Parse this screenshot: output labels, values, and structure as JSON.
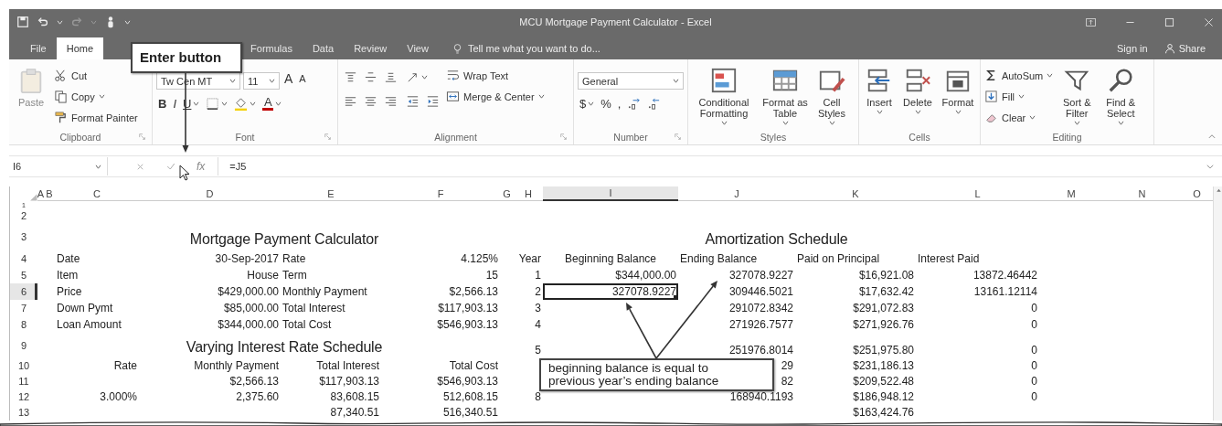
{
  "title_bar": {
    "title": "MCU Mortgage Payment Calculator - Excel"
  },
  "tabs": [
    {
      "label": "File",
      "selected": false
    },
    {
      "label": "Home",
      "selected": true
    },
    {
      "label": "Formulas",
      "selected": false
    },
    {
      "label": "Data",
      "selected": false
    },
    {
      "label": "Review",
      "selected": false
    },
    {
      "label": "View",
      "selected": false
    }
  ],
  "tell_me": {
    "placeholder": "Tell me what you want to do..."
  },
  "account": {
    "sign_in": "Sign in",
    "share": "Share"
  },
  "ribbon": [
    {
      "label": "Clipboard",
      "launcher": true,
      "columns": [
        [
          [
            {
              "kind": "large",
              "label": "Paste",
              "menu": false,
              "disabled": true
            }
          ]
        ],
        [
          [
            {
              "kind": "small",
              "label": "Cut",
              "menu": false,
              "disabled": false
            }
          ],
          [
            {
              "kind": "small",
              "label": "Copy",
              "menu": true,
              "disabled": false
            }
          ],
          [
            {
              "kind": "small",
              "label": "Format Painter",
              "menu": false,
              "disabled": false
            }
          ]
        ]
      ]
    },
    {
      "label": "Font",
      "launcher": true,
      "columns": [
        [
          [
            {
              "kind": "field",
              "value": "Tw Cen MT",
              "menu": true,
              "disabled": false
            },
            {
              "kind": "field",
              "value": "11",
              "menu": true,
              "disabled": false
            },
            {
              "kind": "tool",
              "label": "A",
              "menu": false,
              "disabled": false
            },
            {
              "kind": "tool",
              "label": "A",
              "menu": false,
              "disabled": false
            }
          ],
          [
            {
              "kind": "tool",
              "label": "B",
              "menu": false,
              "disabled": false
            },
            {
              "kind": "tool",
              "label": "I",
              "menu": false,
              "disabled": false
            },
            {
              "kind": "tool",
              "label": "U",
              "menu": true,
              "disabled": false
            },
            {
              "kind": "tool",
              "menu": true,
              "disabled": false
            },
            {
              "kind": "tool",
              "menu": true,
              "disabled": false
            },
            {
              "kind": "tool",
              "label": "A",
              "menu": true,
              "disabled": false
            }
          ]
        ]
      ]
    },
    {
      "label": "Alignment",
      "launcher": true,
      "columns": [
        [
          [
            {
              "kind": "tool",
              "menu": false,
              "disabled": false
            },
            {
              "kind": "tool",
              "menu": false,
              "disabled": false
            },
            {
              "kind": "tool",
              "menu": false,
              "disabled": false
            }
          ],
          [
            {
              "kind": "tool",
              "menu": false,
              "disabled": false
            },
            {
              "kind": "tool",
              "menu": false,
              "disabled": false
            },
            {
              "kind": "tool",
              "menu": false,
              "disabled": false
            }
          ]
        ],
        [
          [
            {
              "kind": "tool",
              "menu": true,
              "disabled": false
            }
          ],
          [
            {
              "kind": "tool",
              "menu": false,
              "disabled": false
            },
            {
              "kind": "tool",
              "menu": false,
              "disabled": false
            }
          ]
        ],
        [
          [
            {
              "kind": "small",
              "label": "Wrap Text",
              "menu": false,
              "disabled": false
            }
          ],
          [
            {
              "kind": "small",
              "label": "Merge & Center",
              "menu": true,
              "disabled": false
            }
          ]
        ]
      ]
    },
    {
      "label": "Number",
      "launcher": true,
      "columns": [
        [
          [
            {
              "kind": "field",
              "value": "General",
              "menu": true,
              "disabled": false
            }
          ],
          [
            {
              "kind": "tool",
              "label": "$",
              "menu": true,
              "disabled": false
            },
            {
              "kind": "tool",
              "label": "%",
              "menu": false,
              "disabled": false
            },
            {
              "kind": "tool",
              "label": ",",
              "menu": false,
              "disabled": false
            },
            {
              "kind": "tool",
              "menu": false,
              "disabled": false
            },
            {
              "kind": "tool",
              "menu": false,
              "disabled": false
            }
          ]
        ]
      ]
    },
    {
      "label": "Styles",
      "launcher": false,
      "columns": [
        [
          [
            {
              "kind": "large",
              "label": "Conditional Formatting",
              "menu": true,
              "disabled": false
            }
          ]
        ],
        [
          [
            {
              "kind": "large",
              "label": "Format as Table",
              "menu": true,
              "disabled": false
            }
          ]
        ],
        [
          [
            {
              "kind": "large",
              "label": "Cell Styles",
              "menu": true,
              "disabled": false
            }
          ]
        ]
      ]
    },
    {
      "label": "Cells",
      "launcher": false,
      "columns": [
        [
          [
            {
              "kind": "large",
              "label": "Insert",
              "menu": true,
              "disabled": false
            }
          ]
        ],
        [
          [
            {
              "kind": "large",
              "label": "Delete",
              "menu": true,
              "disabled": false
            }
          ]
        ],
        [
          [
            {
              "kind": "large",
              "label": "Format",
              "menu": true,
              "disabled": false
            }
          ]
        ]
      ]
    },
    {
      "label": "Editing",
      "launcher": false,
      "columns": [
        [
          [
            {
              "kind": "small",
              "label": "AutoSum",
              "menu": true,
              "disabled": false
            }
          ],
          [
            {
              "kind": "small",
              "label": "Fill",
              "menu": true,
              "disabled": false
            }
          ],
          [
            {
              "kind": "small",
              "label": "Clear",
              "menu": true,
              "disabled": false
            }
          ]
        ],
        [
          [
            {
              "kind": "large",
              "label": "Sort & Filter",
              "menu": true,
              "disabled": false
            }
          ]
        ],
        [
          [
            {
              "kind": "large",
              "label": "Find & Select",
              "menu": true,
              "disabled": false
            }
          ]
        ]
      ]
    }
  ],
  "formula_bar": {
    "name_box": "I6",
    "function_label": "fx",
    "value": "=J5"
  },
  "sheet": {
    "columns": [
      {
        "label": "A",
        "selected": false
      },
      {
        "label": "B",
        "selected": false
      },
      {
        "label": "C",
        "selected": false
      },
      {
        "label": "D",
        "selected": false
      },
      {
        "label": "E",
        "selected": false
      },
      {
        "label": "F",
        "selected": false
      },
      {
        "label": "G",
        "selected": false
      },
      {
        "label": "H",
        "selected": false
      },
      {
        "label": "I",
        "selected": true
      },
      {
        "label": "J",
        "selected": false
      },
      {
        "label": "K",
        "selected": false
      },
      {
        "label": "L",
        "selected": false
      },
      {
        "label": "M",
        "selected": false
      },
      {
        "label": "N",
        "selected": false
      },
      {
        "label": "O",
        "selected": false
      }
    ],
    "rows": [
      {
        "label": "1",
        "selected": false
      },
      {
        "label": "2",
        "selected": false
      },
      {
        "label": "3",
        "selected": false,
        "cells": [
          {
            "kind": "blank"
          },
          {
            "kind": "blank"
          },
          {
            "kind": "title",
            "text": "Mortgage Payment Calculator"
          },
          {
            "kind": "blank"
          },
          {
            "kind": "blank"
          },
          {
            "kind": "blank"
          },
          {
            "kind": "blank"
          },
          {
            "kind": "title",
            "text": "Amortization Schedule"
          },
          {
            "kind": "blank"
          },
          {
            "kind": "blank"
          },
          {
            "kind": "blank"
          },
          {
            "kind": "blank"
          }
        ]
      },
      {
        "label": "4",
        "selected": false,
        "cells": [
          {
            "kind": "blank"
          },
          {
            "kind": "blank"
          },
          {
            "kind": "left",
            "text": "Date"
          },
          {
            "kind": "right",
            "text": "30-Sep-2017"
          },
          {
            "kind": "left",
            "text": "Rate"
          },
          {
            "kind": "right",
            "text": "4.125%"
          },
          {
            "kind": "blank"
          },
          {
            "kind": "right",
            "text": "Year"
          },
          {
            "kind": "center",
            "text": "Beginning Balance"
          },
          {
            "kind": "left",
            "text": "Ending Balance"
          },
          {
            "kind": "left",
            "text": "Paid on Principal"
          },
          {
            "kind": "left",
            "text": "Interest Paid"
          }
        ]
      },
      {
        "label": "5",
        "selected": false,
        "cells": [
          {
            "kind": "blank"
          },
          {
            "kind": "blank"
          },
          {
            "kind": "left",
            "text": "Item"
          },
          {
            "kind": "right",
            "text": "House"
          },
          {
            "kind": "left",
            "text": "Term"
          },
          {
            "kind": "right",
            "text": "15"
          },
          {
            "kind": "blank"
          },
          {
            "kind": "right",
            "text": "1"
          },
          {
            "kind": "right",
            "text": "$344,000.00"
          },
          {
            "kind": "right",
            "text": "327078.9227"
          },
          {
            "kind": "right",
            "text": "$16,921.08"
          },
          {
            "kind": "right",
            "text": "13872.46442"
          }
        ]
      },
      {
        "label": "6",
        "selected": true,
        "cells": [
          {
            "kind": "blank"
          },
          {
            "kind": "blank"
          },
          {
            "kind": "left",
            "text": "Price"
          },
          {
            "kind": "right",
            "text": "$429,000.00"
          },
          {
            "kind": "left",
            "text": "Monthly Payment"
          },
          {
            "kind": "right",
            "text": "$2,566.13"
          },
          {
            "kind": "blank"
          },
          {
            "kind": "right",
            "text": "2"
          },
          {
            "kind": "right",
            "text": "327078.9227"
          },
          {
            "kind": "right",
            "text": "309446.5021"
          },
          {
            "kind": "right",
            "text": "$17,632.42"
          },
          {
            "kind": "right",
            "text": "13161.12114"
          }
        ]
      },
      {
        "label": "7",
        "selected": false,
        "cells": [
          {
            "kind": "blank"
          },
          {
            "kind": "blank"
          },
          {
            "kind": "left",
            "text": "Down Pymt"
          },
          {
            "kind": "right",
            "text": "$85,000.00"
          },
          {
            "kind": "left",
            "text": "Total Interest"
          },
          {
            "kind": "right",
            "text": "$117,903.13"
          },
          {
            "kind": "blank"
          },
          {
            "kind": "right",
            "text": "3"
          },
          {
            "kind": "blank"
          },
          {
            "kind": "right",
            "text": "291072.8342"
          },
          {
            "kind": "right",
            "text": "$291,072.83"
          },
          {
            "kind": "right",
            "text": "0"
          }
        ]
      },
      {
        "label": "8",
        "selected": false,
        "cells": [
          {
            "kind": "blank"
          },
          {
            "kind": "blank"
          },
          {
            "kind": "left",
            "text": "Loan Amount"
          },
          {
            "kind": "right",
            "text": "$344,000.00"
          },
          {
            "kind": "left",
            "text": "Total Cost"
          },
          {
            "kind": "right",
            "text": "$546,903.13"
          },
          {
            "kind": "blank"
          },
          {
            "kind": "right",
            "text": "4"
          },
          {
            "kind": "blank"
          },
          {
            "kind": "right",
            "text": "271926.7577"
          },
          {
            "kind": "right",
            "text": "$271,926.76"
          },
          {
            "kind": "right",
            "text": "0"
          }
        ]
      },
      {
        "label": "9",
        "selected": false,
        "cells": [
          {
            "kind": "blank"
          },
          {
            "kind": "blank"
          },
          {
            "kind": "title",
            "text": "Varying Interest Rate Schedule"
          },
          {
            "kind": "blank"
          },
          {
            "kind": "blank"
          },
          {
            "kind": "blank"
          },
          {
            "kind": "blank"
          },
          {
            "kind": "right",
            "text": "5"
          },
          {
            "kind": "blank"
          },
          {
            "kind": "right",
            "text": "251976.8014"
          },
          {
            "kind": "right",
            "text": "$251,975.80"
          },
          {
            "kind": "right",
            "text": "0"
          }
        ]
      },
      {
        "label": "10",
        "selected": false,
        "cells": [
          {
            "kind": "blank"
          },
          {
            "kind": "blank"
          },
          {
            "kind": "right",
            "text": "Rate"
          },
          {
            "kind": "right",
            "text": "Monthly Payment"
          },
          {
            "kind": "right",
            "text": "Total Interest"
          },
          {
            "kind": "right",
            "text": "Total Cost"
          },
          {
            "kind": "blank"
          },
          {
            "kind": "blank"
          },
          {
            "kind": "blank"
          },
          {
            "kind": "right",
            "text": "29"
          },
          {
            "kind": "right",
            "text": "$231,186.13"
          },
          {
            "kind": "right",
            "text": "0"
          }
        ]
      },
      {
        "label": "11",
        "selected": false,
        "cells": [
          {
            "kind": "blank"
          },
          {
            "kind": "blank"
          },
          {
            "kind": "blank"
          },
          {
            "kind": "right",
            "text": "$2,566.13"
          },
          {
            "kind": "right",
            "text": "$117,903.13"
          },
          {
            "kind": "right",
            "text": "$546,903.13"
          },
          {
            "kind": "blank"
          },
          {
            "kind": "blank"
          },
          {
            "kind": "blank"
          },
          {
            "kind": "right",
            "text": "82"
          },
          {
            "kind": "right",
            "text": "$209,522.48"
          },
          {
            "kind": "right",
            "text": "0"
          }
        ]
      },
      {
        "label": "12",
        "selected": false,
        "cells": [
          {
            "kind": "blank"
          },
          {
            "kind": "blank"
          },
          {
            "kind": "right",
            "text": "3.000%"
          },
          {
            "kind": "right",
            "text": "2,375.60"
          },
          {
            "kind": "right",
            "text": "83,608.15"
          },
          {
            "kind": "right",
            "text": "512,608.15"
          },
          {
            "kind": "blank"
          },
          {
            "kind": "right",
            "text": "8"
          },
          {
            "kind": "blank"
          },
          {
            "kind": "right",
            "text": "168940.1193"
          },
          {
            "kind": "right",
            "text": "$186,948.12"
          },
          {
            "kind": "right",
            "text": "0"
          }
        ]
      },
      {
        "label": "13",
        "selected": false,
        "cells": [
          {
            "kind": "blank"
          },
          {
            "kind": "blank"
          },
          {
            "kind": "blank"
          },
          {
            "kind": "blank"
          },
          {
            "kind": "right",
            "text": "87,340.51"
          },
          {
            "kind": "right",
            "text": "516,340.51"
          },
          {
            "kind": "blank"
          },
          {
            "kind": "blank"
          },
          {
            "kind": "blank"
          },
          {
            "kind": "blank"
          },
          {
            "kind": "right",
            "text": "$163,424.76"
          }
        ]
      }
    ]
  },
  "callouts": [
    {
      "text": "Enter button"
    },
    {
      "text": "beginning balance is equal to\nprevious year’s ending balance"
    }
  ]
}
